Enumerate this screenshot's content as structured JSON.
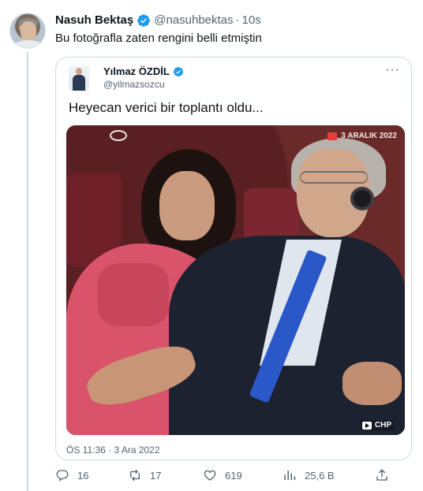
{
  "tweet": {
    "author_name": "Nasuh Bektaş",
    "author_handle": "@nasuhbektas",
    "separator": "·",
    "time_ago": "10s",
    "text": "Bu fotoğrafla zaten rengini belli etmiştin"
  },
  "quoted_tweet": {
    "author_name": "Yılmaz ÖZDİL",
    "author_handle": "@yilmazsozcu",
    "more": "···",
    "text": "Heyecan verici bir toplantı oldu...",
    "video_date_overlay": "3 ARALIK 2022",
    "video_channel_badge": "CHP",
    "timestamp": "ÖS 11:36 · 3 Ara 2022"
  },
  "actions": {
    "reply_count": "16",
    "retweet_count": "17",
    "like_count": "619",
    "view_count": "25,6 B"
  },
  "icons": {
    "verified": "verified-badge-icon",
    "reply": "reply-icon",
    "retweet": "retweet-icon",
    "like": "heart-icon",
    "views": "views-bar-chart-icon",
    "share": "share-icon"
  },
  "colors": {
    "verified_blue": "#1d9bf0",
    "secondary_text": "#536471",
    "tie_blue": "#2b58c9",
    "jacket_pink": "#d9536a"
  }
}
